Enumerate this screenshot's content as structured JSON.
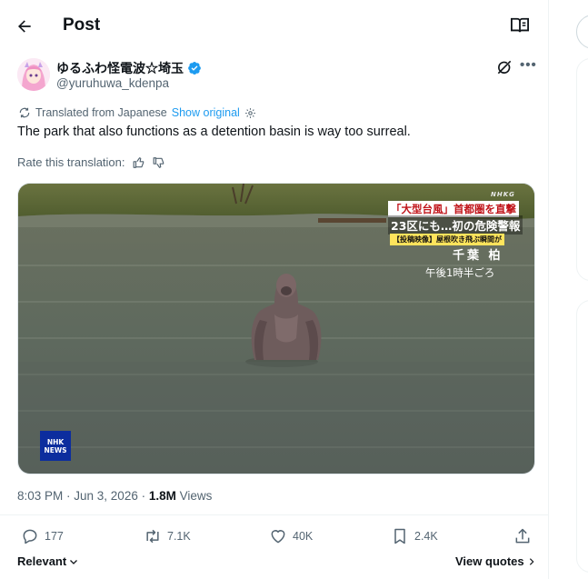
{
  "header": {
    "title": "Post"
  },
  "author": {
    "name": "ゆるふわ怪電波☆埼玉",
    "handle": "@yuruhuwa_kdenpa"
  },
  "translation": {
    "label": "Translated from Japanese",
    "show_original": "Show original"
  },
  "tweet": {
    "text": "The park that also functions as a detention basin is way too surreal."
  },
  "rate": {
    "label": "Rate this translation:"
  },
  "media": {
    "overlay_channel": "NHKG",
    "overlay_banner": "「大型台風」首都圏を直撃",
    "overlay_headline": "23区にも…初の危険警報",
    "overlay_sub": "【投稿映像】屋根吹き飛ぶ瞬間が",
    "overlay_place": "千葉 柏",
    "overlay_time": "午後1時半ごろ",
    "logo_line1": "NHK",
    "logo_line2": "NEWS"
  },
  "meta": {
    "time": "8:03 PM · Jun 3, 2026 · ",
    "views_count": "1.8M",
    "views_label": " Views"
  },
  "actions": {
    "replies": "177",
    "reposts": "7.1K",
    "likes": "40K",
    "bookmarks": "2.4K"
  },
  "footer": {
    "relevant": "Relevant",
    "view_quotes": "View quotes"
  },
  "colors": {
    "accent": "#1d9bf0",
    "text": "#0f1419",
    "muted": "#536471"
  }
}
